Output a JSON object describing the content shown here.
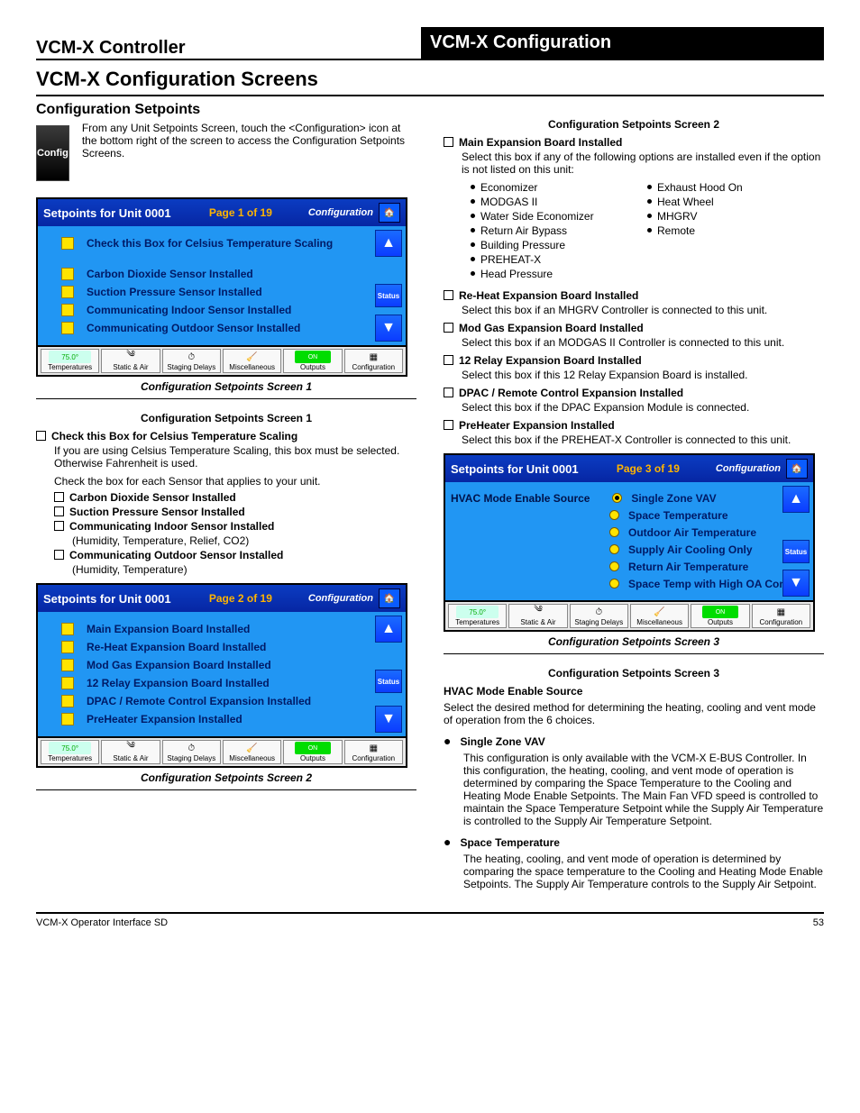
{
  "header": {
    "left": "VCM-X Controller",
    "right": "VCM-X Configuration"
  },
  "section_title": "VCM-X Configuration Screens",
  "subsection": "Configuration Setpoints",
  "tile_label": "Config",
  "intro": "From any Unit Setpoints Screen, touch the <Configuration> icon at the bottom right of the screen to access the Configuration Setpoints Screens.",
  "panel1": {
    "title": "Setpoints for Unit 0001",
    "page": "Page 1 of 19",
    "cfg": "Configuration",
    "items": [
      "Check this Box for Celsius Temperature Scaling",
      "Carbon Dioxide Sensor Installed",
      "Suction Pressure Sensor Installed",
      "Communicating Indoor Sensor Installed",
      "Communicating Outdoor Sensor Installed"
    ]
  },
  "caption1": "Configuration Setpoints Screen 1",
  "cfg1_heading": "Configuration Setpoints Screen 1",
  "c1": {
    "celsius": "Check this Box for Celsius Temperature Scaling",
    "celsius_desc1": "If you are using Celsius Temperature Scaling, this box must be selected. Otherwise Fahrenheit is used.",
    "celsius_desc2": "Check the box for each Sensor that applies to your unit.",
    "sensors": [
      "Carbon Dioxide Sensor Installed",
      "Suction Pressure Sensor Installed",
      "Communicating Indoor Sensor Installed"
    ],
    "sensor_htrc": "(Humidity, Temperature, Relief, CO2)",
    "sensor_outdoor": "Communicating Outdoor Sensor Installed",
    "sensor_outdoor_note": "(Humidity, Temperature)"
  },
  "panel2": {
    "title": "Setpoints for Unit 0001",
    "page": "Page 2 of 19",
    "cfg": "Configuration",
    "items": [
      "Main Expansion Board Installed",
      "Re-Heat Expansion Board Installed",
      "Mod Gas Expansion Board Installed",
      "12 Relay Expansion Board Installed",
      "DPAC / Remote Control Expansion Installed",
      "PreHeater Expansion Installed"
    ]
  },
  "caption2": "Configuration Setpoints Screen 2",
  "cfg2_heading": "Configuration Setpoints Screen 2",
  "c2": {
    "main_label": "Main Expansion Board Installed",
    "main_desc": "Select this box if any of the following options are installed even if the option is not listed on this unit:",
    "main_opts_left": [
      "Economizer",
      "MODGAS II",
      "Water Side Economizer",
      "Return Air Bypass",
      "Building Pressure",
      "PREHEAT-X",
      "Head Pressure"
    ],
    "main_opts_right": [
      "Exhaust Hood On",
      "Heat Wheel",
      "MHGRV",
      "Remote"
    ],
    "reheat_label": "Re-Heat Expansion Board Installed",
    "reheat_desc": "Select this box if an MHGRV Controller is connected to this unit.",
    "modgas_label": "Mod Gas Expansion Board Installed",
    "modgas_desc": "Select this box if an MODGAS II Controller is connected to this unit.",
    "relay_label": "12 Relay Expansion Board Installed",
    "relay_desc": "Select this box if this 12 Relay Expansion Board is installed.",
    "dpac_label": "DPAC / Remote Control Expansion Installed",
    "dpac_desc": "Select this box if the DPAC Expansion Module is connected.",
    "preheat_label": "PreHeater Expansion Installed",
    "preheat_desc": "Select this box if the PREHEAT-X Controller is connected to this unit."
  },
  "panel3": {
    "title": "Setpoints for Unit 0001",
    "page": "Page 3 of 19",
    "cfg": "Configuration",
    "lead": "HVAC Mode Enable Source",
    "opts": [
      "Single Zone VAV",
      "Space Temperature",
      "Outdoor Air Temperature",
      "Supply Air Cooling Only",
      "Return Air Temperature",
      "Space Temp with High OA Content"
    ]
  },
  "caption3": "Configuration Setpoints Screen 3",
  "c3": {
    "heading": "Configuration Setpoints Screen 3",
    "lead": "HVAC Mode Enable Source",
    "lead_desc": "Select the desired method for determining the heating, cooling and vent mode of operation from the 6 choices.",
    "szvav_label": "Single Zone VAV",
    "szvav_desc": "This configuration is only available with the VCM-X E-BUS Controller. In this configuration, the heating, cooling, and vent mode of operation is determined by comparing the Space Temperature to the Cooling and Heating Mode Enable Setpoints. The Main Fan VFD speed is controlled to maintain the Space Temperature Setpoint while the Supply Air Temperature is controlled to the Supply Air Temperature Setpoint.",
    "space_label": "Space Temperature",
    "space_desc": "The heating, cooling, and vent mode of operation is determined by comparing the space temperature to the Cooling and Heating Mode Enable Setpoints. The Supply Air Temperature controls to the Supply Air Setpoint."
  },
  "footer_nav": [
    "Temperatures",
    "Static & Air",
    "Staging Delays",
    "Miscellaneous",
    "Outputs",
    "Configuration"
  ],
  "page_footer": {
    "left": "VCM-X Operator Interface SD",
    "right": "53"
  }
}
